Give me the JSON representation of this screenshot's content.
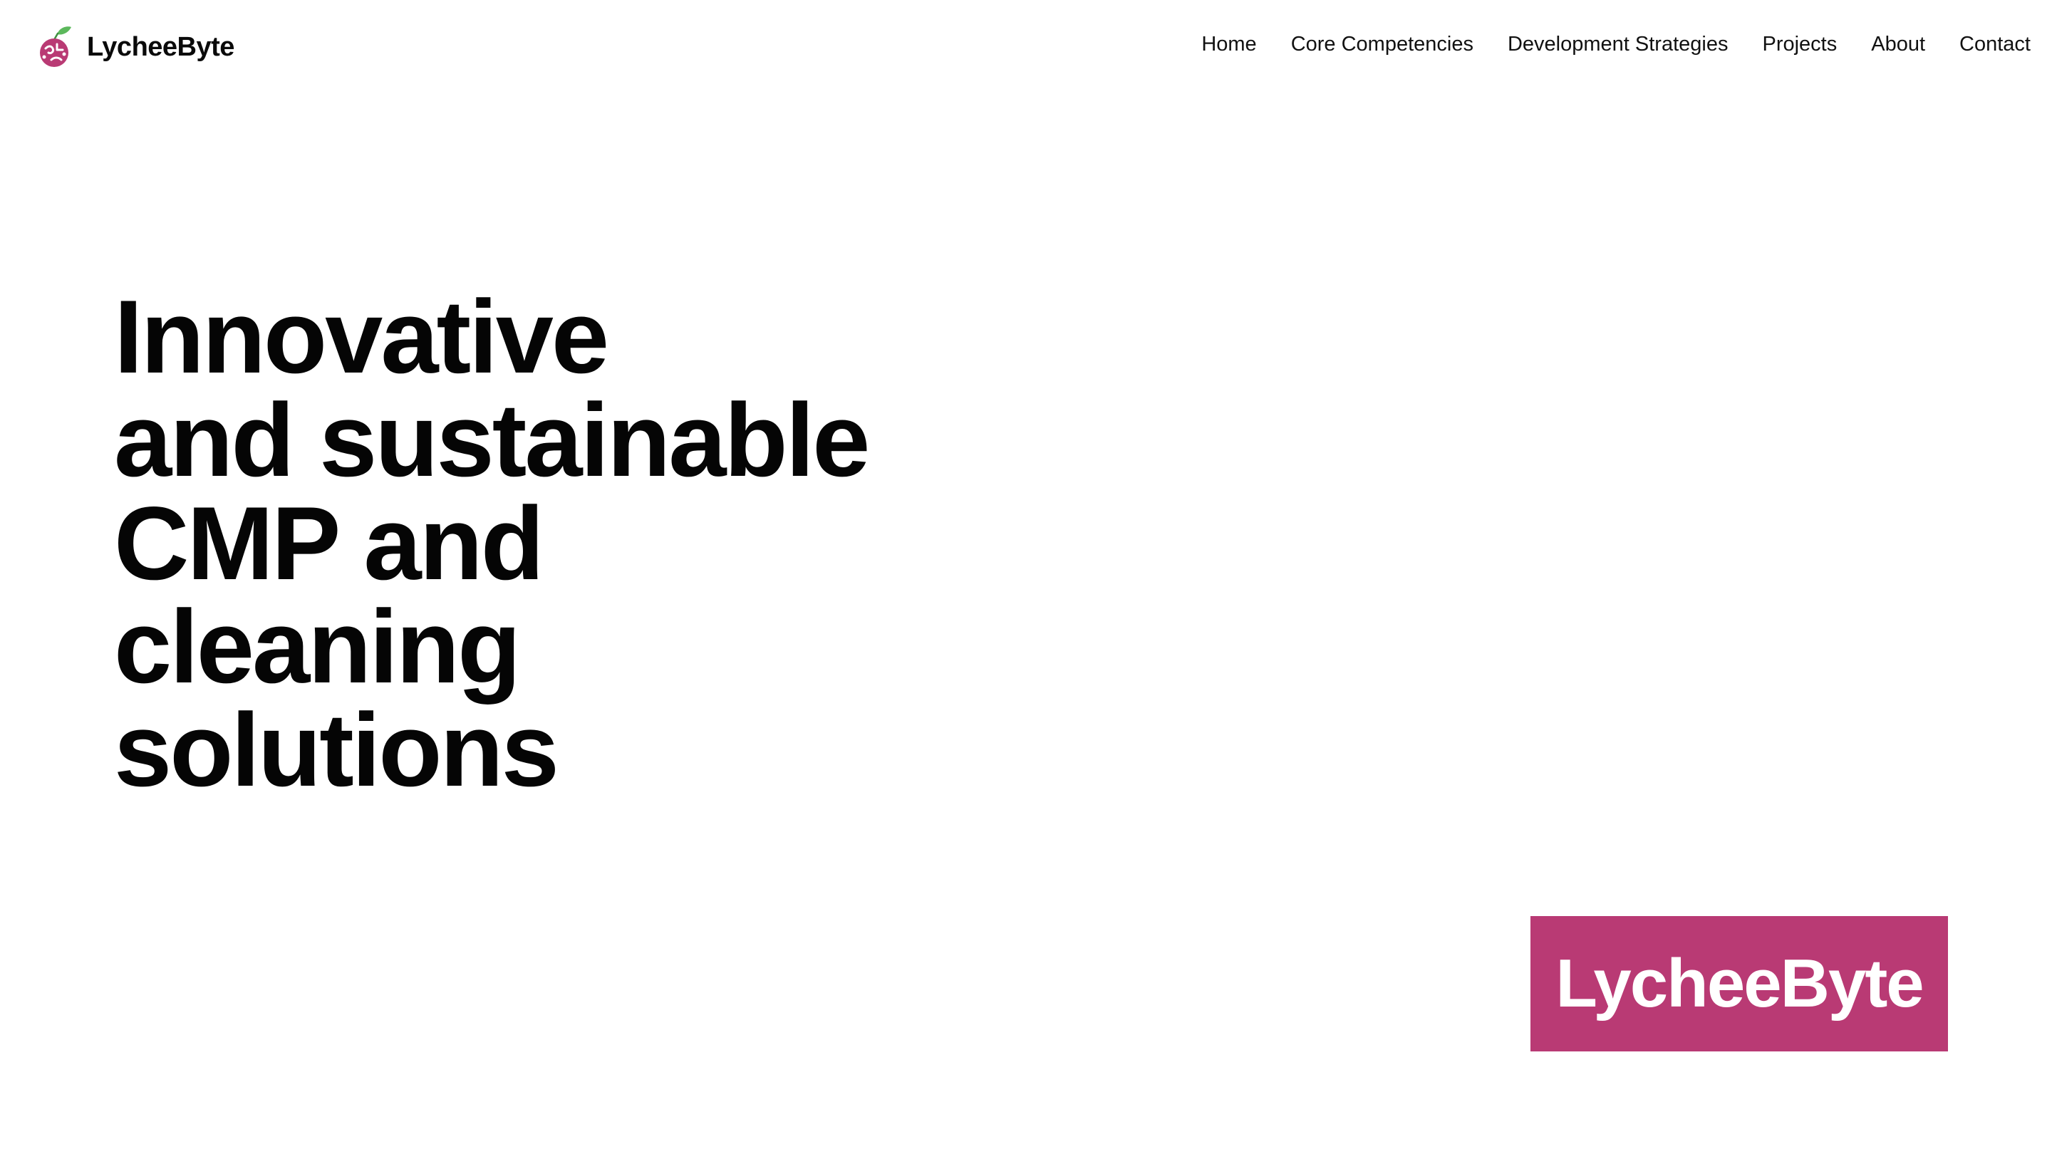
{
  "header": {
    "brand": {
      "name": "LycheeByte",
      "logo_icon": "lychee-logo-icon"
    },
    "nav": {
      "items": [
        {
          "label": "Home"
        },
        {
          "label": "Core Competencies"
        },
        {
          "label": "Development Strategies"
        },
        {
          "label": "Projects"
        },
        {
          "label": "About"
        },
        {
          "label": "Contact"
        }
      ]
    }
  },
  "hero": {
    "title_lines": [
      "Innovative",
      "and sustainable",
      "CMP and",
      "cleaning",
      "solutions"
    ]
  },
  "badge": {
    "label": "LycheeByte"
  },
  "colors": {
    "brand": "#b93a74",
    "leaf": "#5cb85c",
    "text": "#0a0a0a",
    "background": "#ffffff"
  }
}
